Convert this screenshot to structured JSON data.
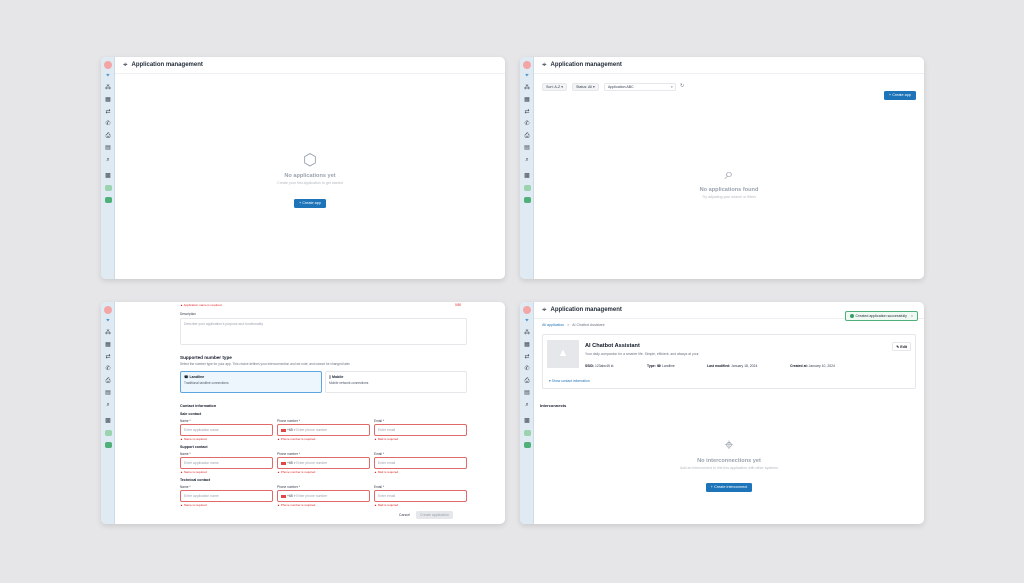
{
  "header_title": "Application management",
  "panel1": {
    "empty_title": "No applications yet",
    "empty_sub": "Create your first application to get started",
    "create_btn": "Create app"
  },
  "panel2": {
    "sort": "Sort: A-Z",
    "status": "Status: All",
    "search_value": "Application ABC",
    "create_btn": "Create app",
    "empty_title": "No applications found",
    "empty_sub": "Try adjusting your search or filters"
  },
  "panel3": {
    "name_err": "Application name is required",
    "count": "0/50",
    "desc_label": "Description",
    "desc_placeholder": "Describe your application's purpose and functionality",
    "supported_title": "Supported number type",
    "supported_sub": "Select the number type for your app. This choice defines your interconnection and we note, and cannot be changed later.",
    "opt1_title": "Landline",
    "opt1_desc": "Traditional landline connections",
    "opt2_title": "Mobile",
    "opt2_desc": "Mobile network connections",
    "contact_title": "Contact information",
    "sections": [
      {
        "title": "Sale contact"
      },
      {
        "title": "Support contact"
      },
      {
        "title": "Technical contact"
      }
    ],
    "name_label": "Name *",
    "phone_label": "Phone number *",
    "email_label": "Email *",
    "name_placeholder": "Enter application name",
    "phone_code": "+65",
    "phone_placeholder": "Enter phone number",
    "email_placeholder": "Enter email",
    "name_error": "Name is required",
    "phone_error": "Phone number is required",
    "email_error": "Mail is required",
    "cancel": "Cancel",
    "create_app": "Create application"
  },
  "panel4": {
    "crumb_root": "All application",
    "crumb_sep": ">",
    "crumb_current": "AI Chatbot Assistant",
    "toast": "Created application successfully",
    "toast_close": "×",
    "card_title": "AI Chatbot Assistant",
    "card_desc": "Your daily companion for a smarter life. Simple, efficient, and always at your.",
    "edit": "Edit",
    "meta": {
      "ssid_label": "SSID:",
      "ssid_value": "123abc45",
      "type_label": "Type:",
      "type_value": "Landline",
      "modified_label": "Last modified:",
      "modified_value": "January 18, 2024",
      "created_label": "Created at:",
      "created_value": "January 10, 2024"
    },
    "show_contact": "Show contact information",
    "interconnects": "Interconnects",
    "empty_title": "No interconnections yet",
    "empty_sub": "Add an interconnect to link this application with other systems",
    "create_btn": "Create interconnect"
  }
}
